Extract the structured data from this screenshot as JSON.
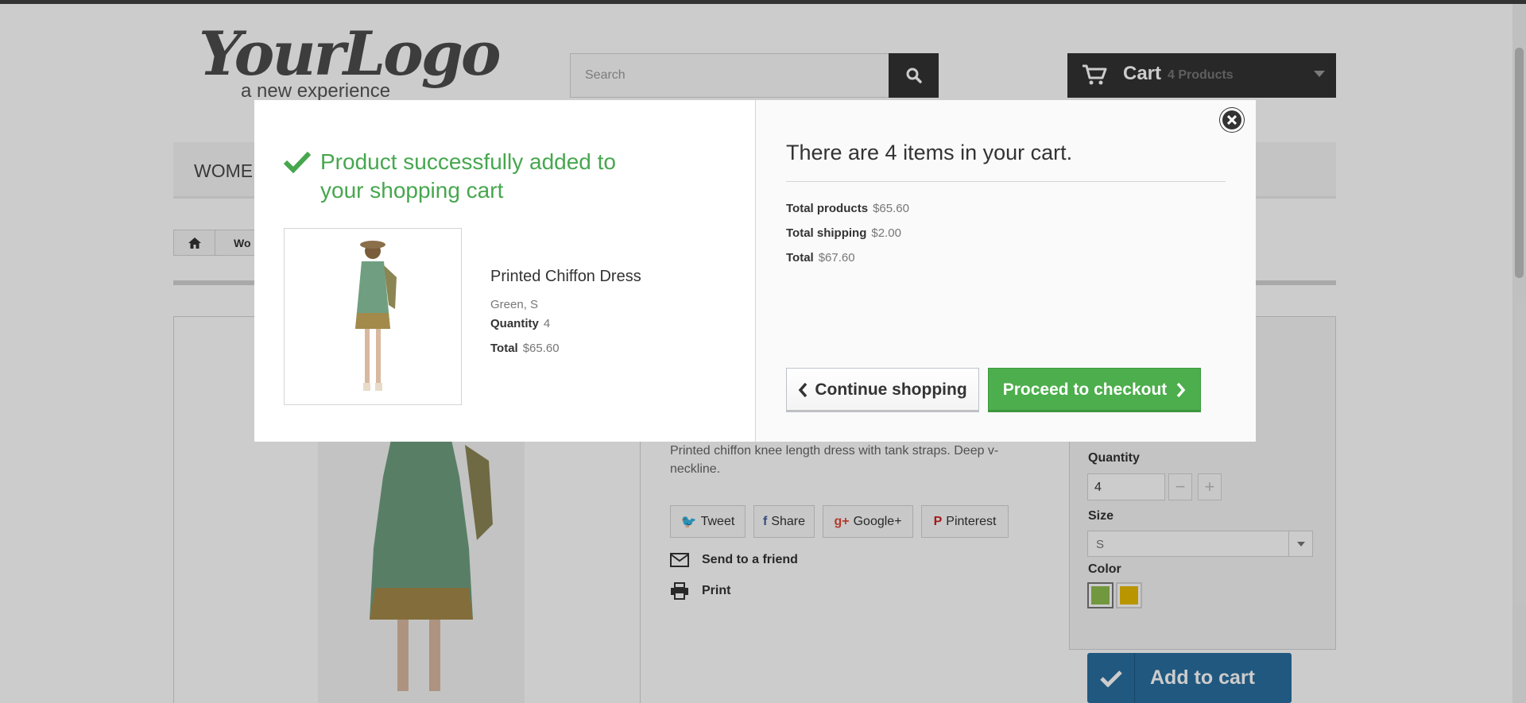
{
  "header": {
    "logo_main": "YourLogo",
    "logo_sub": "a new experience",
    "search_placeholder": "Search",
    "search_icon": "search-icon",
    "cart_label": "Cart",
    "cart_count": "4 Products"
  },
  "menu": {
    "first_item": "WOMEN"
  },
  "breadcrumb": {
    "item": "Wo"
  },
  "product_page": {
    "description": "Printed chiffon knee length dress with tank straps. Deep v-neckline.",
    "social": [
      {
        "icon": "twitter-icon",
        "glyph": "🐦",
        "label": "Tweet"
      },
      {
        "icon": "facebook-icon",
        "glyph": "f",
        "label": "Share"
      },
      {
        "icon": "googleplus-icon",
        "glyph": "g+",
        "label": "Google+"
      },
      {
        "icon": "pinterest-icon",
        "glyph": "P",
        "label": "Pinterest"
      }
    ],
    "send_to_friend": "Send to a friend",
    "print": "Print",
    "quantity_label": "Quantity",
    "quantity_value": "4",
    "size_label": "Size",
    "size_value": "S",
    "color_label": "Color",
    "colors": [
      "#8fbf4f",
      "#e8bb00"
    ],
    "add_to_cart": "Add to cart"
  },
  "modal": {
    "success_title": "Product successfully added to your shopping cart",
    "product_name": "Printed Chiffon Dress",
    "product_attributes": "Green, S",
    "quantity_label": "Quantity",
    "quantity_value": "4",
    "total_label": "Total",
    "total_value": "$65.60",
    "cart_summary_title": "There are 4 items in your cart.",
    "total_products_label": "Total products",
    "total_products_value": "$65.60",
    "total_shipping_label": "Total shipping",
    "total_shipping_value": "$2.00",
    "grand_total_label": "Total",
    "grand_total_value": "$67.60",
    "continue_label": "Continue shopping",
    "checkout_label": "Proceed to checkout"
  },
  "colors": {
    "success_green": "#46a74e",
    "checkout_green": "#4cae4c",
    "dark": "#333333",
    "add_to_cart_blue": "#2a6e9f"
  }
}
